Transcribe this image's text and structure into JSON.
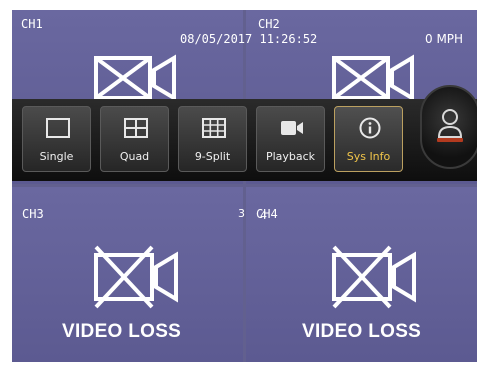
{
  "overlay": {
    "timestamp": "08/05/2017 11:26:52",
    "speed": "0 MPH"
  },
  "channels": [
    {
      "label": "CH1"
    },
    {
      "label": "CH2"
    },
    {
      "label": "CH3",
      "status": "VIDEO LOSS"
    },
    {
      "label": "CH4",
      "status": "VIDEO LOSS"
    }
  ],
  "toolbar": {
    "buttons": [
      {
        "label": "Single",
        "icon": "single-view-icon"
      },
      {
        "label": "Quad",
        "icon": "quad-view-icon"
      },
      {
        "label": "9-Split",
        "icon": "nine-split-icon"
      },
      {
        "label": "Playback",
        "icon": "video-camera-icon"
      },
      {
        "label": "Sys Info",
        "icon": "info-icon",
        "active": true
      }
    ],
    "user_icon": "user-icon"
  },
  "markers": {
    "num_left": "3",
    "num_right": "4"
  },
  "colors": {
    "background": "#62608f",
    "active_label": "#f1c54a",
    "user_accent": "#b23a1f"
  }
}
